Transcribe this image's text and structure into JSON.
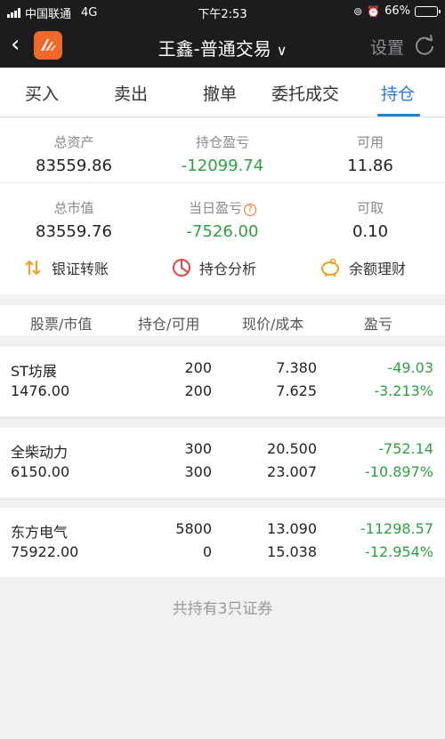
{
  "status_bar": {
    "carrier": "中国联通",
    "network": "4G",
    "time": "下午2:53",
    "battery": "66%",
    "battery_level": 0.66
  },
  "nav": {
    "title": "王鑫-普通交易",
    "settings": "设置"
  },
  "tabs": [
    "买入",
    "卖出",
    "撤单",
    "委托成交",
    "持仓"
  ],
  "active_tab": "持仓",
  "summary": {
    "total_assets_label": "总资产",
    "total_assets": "83559.86",
    "position_pl_label": "持仓盈亏",
    "position_pl": "-12099.74",
    "available_label": "可用",
    "available": "11.86",
    "market_value_label": "总市值",
    "market_value": "83559.76",
    "today_pl_label": "当日盈亏",
    "today_pl": "-7526.00",
    "withdrawable_label": "可取",
    "withdrawable": "0.10"
  },
  "actions": {
    "bank_transfer": "银证转账",
    "position_analysis": "持仓分析",
    "wealth": "余额理财"
  },
  "table": {
    "headers": [
      "股票/市值",
      "持仓/可用",
      "现价/成本",
      "盈亏"
    ],
    "rows": [
      {
        "name": "ST坊展",
        "market_value": "1476.00",
        "position": "200",
        "available": "200",
        "price": "7.380",
        "cost": "7.625",
        "pl": "-49.03",
        "pl_pct": "-3.213%"
      },
      {
        "name": "全柴动力",
        "market_value": "6150.00",
        "position": "300",
        "available": "300",
        "price": "20.500",
        "cost": "23.007",
        "pl": "-752.14",
        "pl_pct": "-10.897%"
      },
      {
        "name": "东方电气",
        "market_value": "75922.00",
        "position": "5800",
        "available": "0",
        "price": "13.090",
        "cost": "15.038",
        "pl": "-11298.57",
        "pl_pct": "-12.954%"
      }
    ]
  },
  "footer": "共持有3只证券",
  "colors": {
    "accent": "#2a7bd8",
    "loss_green": "#2ea043",
    "brand_orange": "#ef6a2a",
    "dark_bar": "#1c1c1e"
  }
}
